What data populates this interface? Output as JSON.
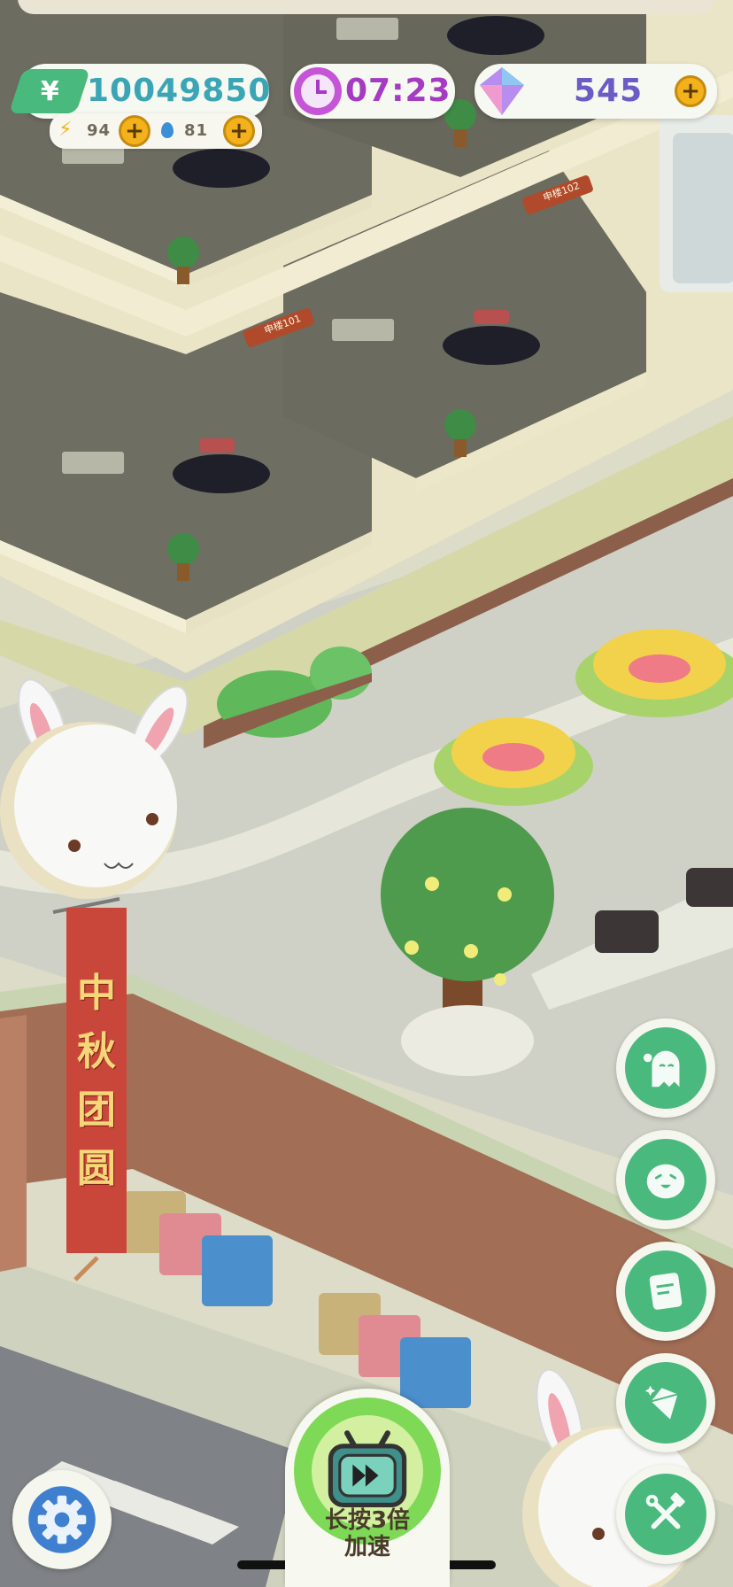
{
  "hud": {
    "money": {
      "icon": "yen-icon",
      "value": "10049850"
    },
    "timer": {
      "icon": "clock-icon",
      "value": "07:23"
    },
    "gems": {
      "icon": "gem-icon",
      "value": "545"
    },
    "energy": {
      "icon": "lightning-icon",
      "value": "94"
    },
    "water": {
      "icon": "water-drop-icon",
      "value": "81"
    }
  },
  "scene": {
    "room_signs": [
      "申楼102",
      "申楼101"
    ],
    "banner_text": [
      "中",
      "秋",
      "团",
      "圆"
    ]
  },
  "side_buttons": [
    {
      "name": "ghost-button",
      "icon": "ghost-icon"
    },
    {
      "name": "emoji-button",
      "icon": "laughing-face-icon"
    },
    {
      "name": "notes-button",
      "icon": "notepad-icon"
    },
    {
      "name": "gem-shop-button",
      "icon": "diamond-icon"
    },
    {
      "name": "tools-button",
      "icon": "hammer-wrench-icon"
    }
  ],
  "speed_button": {
    "line1": "长按3倍",
    "line2": "加速",
    "icon": "fast-forward-tv-icon"
  },
  "settings_button": {
    "icon": "gear-icon"
  },
  "colors": {
    "accent_green": "#4ab97d",
    "money_teal": "#3aa6b5",
    "timer_purple": "#a53bc2",
    "gem_purple": "#6a5bc7",
    "plus_gold": "#f3b21b",
    "banner_red": "#c9473a"
  }
}
